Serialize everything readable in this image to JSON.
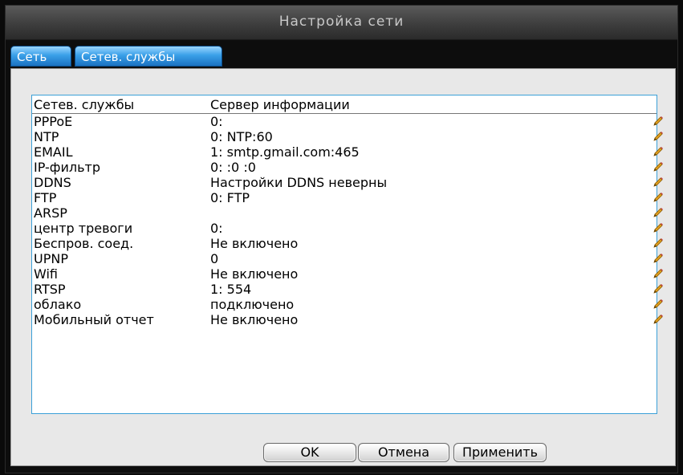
{
  "window": {
    "title": "Настройка сети"
  },
  "tabs": [
    {
      "label": "Сеть"
    },
    {
      "label": "Сетев. службы"
    }
  ],
  "table": {
    "headers": [
      "Сетев. службы",
      "Сервер информации"
    ],
    "rows": [
      {
        "service": "PPPoE",
        "info": "0:"
      },
      {
        "service": "NTP",
        "info": "0: NTP:60"
      },
      {
        "service": "EMAIL",
        "info": "1: smtp.gmail.com:465"
      },
      {
        "service": "IP-фильтр",
        "info": "0: :0 :0"
      },
      {
        "service": "DDNS",
        "info": "Настройки DDNS неверны"
      },
      {
        "service": "FTP",
        "info": "0: FTP"
      },
      {
        "service": "ARSP",
        "info": ""
      },
      {
        "service": "центр тревоги",
        "info": "0:"
      },
      {
        "service": "Беспров. соед.",
        "info": "Не включено"
      },
      {
        "service": "UPNP",
        "info": "0"
      },
      {
        "service": "Wifi",
        "info": "Не включено"
      },
      {
        "service": "RTSP",
        "info": "1: 554"
      },
      {
        "service": "облако",
        "info": "подключено"
      },
      {
        "service": "Мобильный отчет",
        "info": "Не включено"
      }
    ],
    "edit_icon": "pencil-edit-icon"
  },
  "buttons": {
    "ok": "OK",
    "cancel": "Отмена",
    "apply": "Применить"
  },
  "colors": {
    "tab_active": "#3aa0e8",
    "list_border": "#3ba0d8",
    "pencil": "#e0a020"
  }
}
